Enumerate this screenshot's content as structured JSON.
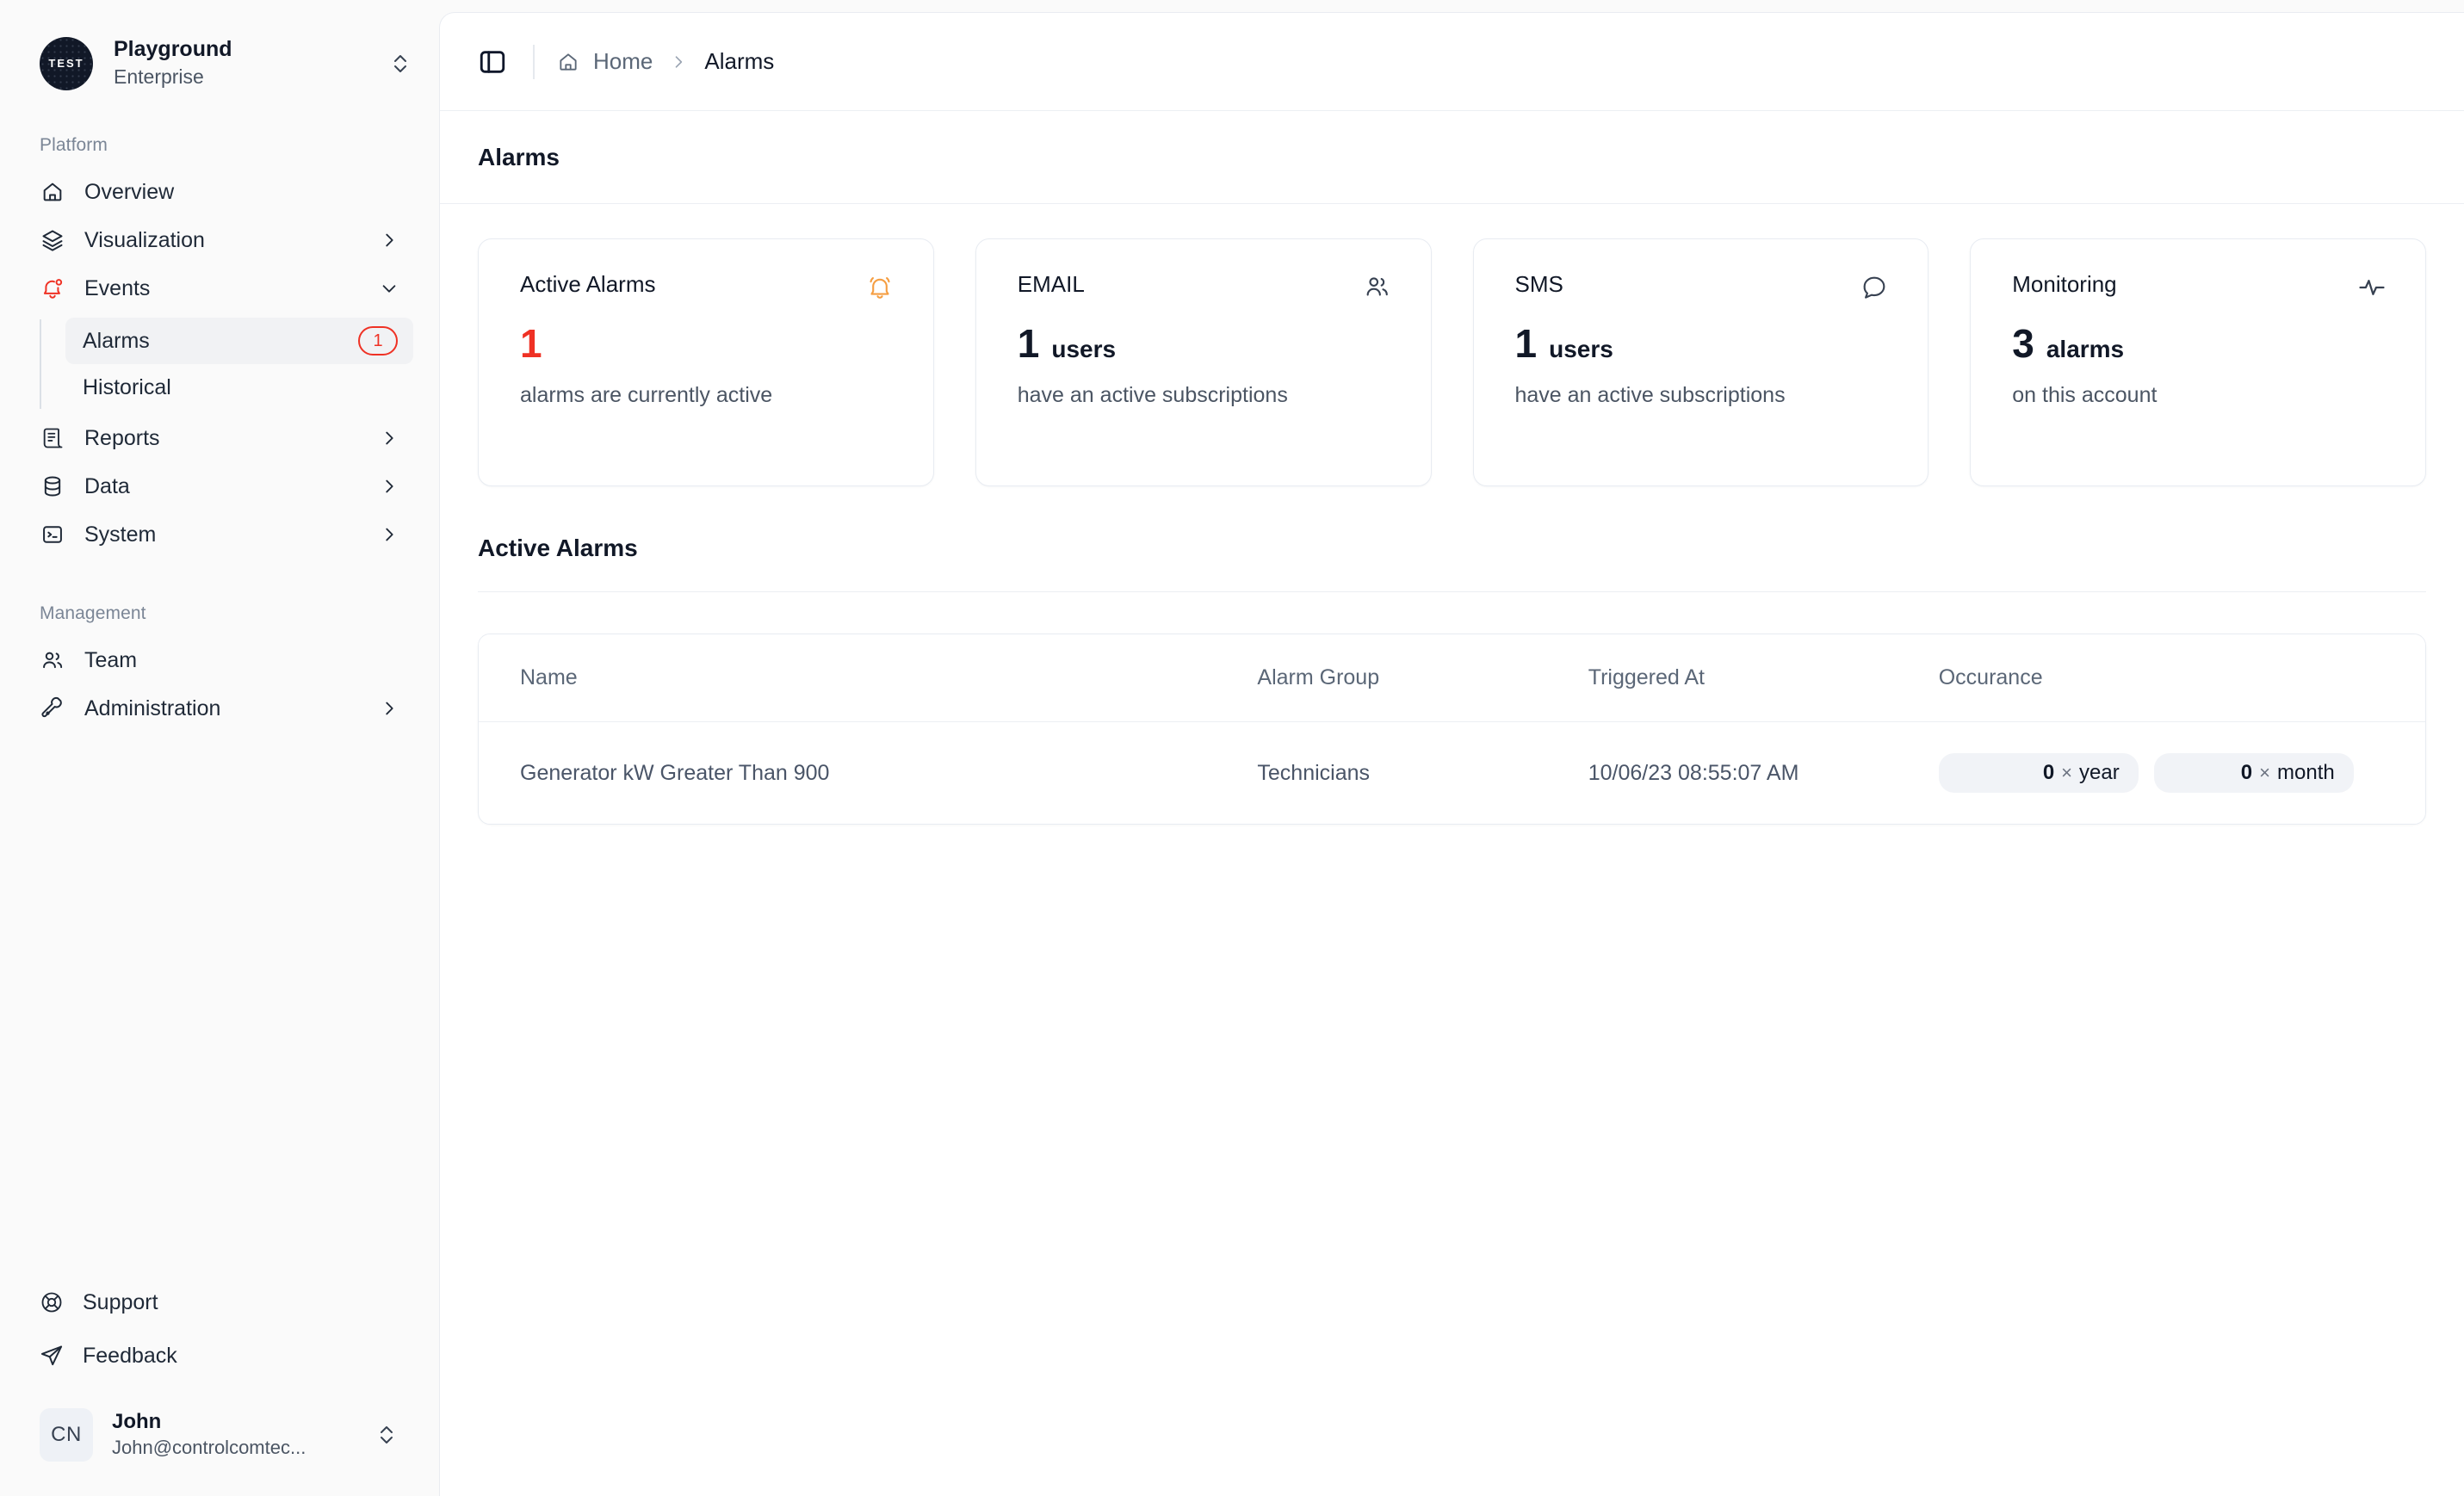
{
  "workspace": {
    "logo_text": "TEST",
    "name": "Playground",
    "plan": "Enterprise",
    "switcher_icon": "chevron-up-down-icon"
  },
  "sidebar": {
    "groups": [
      {
        "label": "Platform",
        "items": [
          {
            "label": "Overview",
            "icon": "home-icon",
            "expandable": false
          },
          {
            "label": "Visualization",
            "icon": "layers-icon",
            "expandable": true,
            "chevron": "chevron-right-icon"
          },
          {
            "label": "Events",
            "icon": "bell-alert-icon",
            "expandable": true,
            "chevron": "chevron-down-icon",
            "expanded": true,
            "children": [
              {
                "label": "Alarms",
                "active": true,
                "badge": "1"
              },
              {
                "label": "Historical",
                "active": false,
                "badge": null
              }
            ]
          },
          {
            "label": "Reports",
            "icon": "report-icon",
            "expandable": true,
            "chevron": "chevron-right-icon"
          },
          {
            "label": "Data",
            "icon": "database-icon",
            "expandable": true,
            "chevron": "chevron-right-icon"
          },
          {
            "label": "System",
            "icon": "terminal-icon",
            "expandable": true,
            "chevron": "chevron-right-icon"
          }
        ]
      },
      {
        "label": "Management",
        "items": [
          {
            "label": "Team",
            "icon": "users-icon",
            "expandable": false
          },
          {
            "label": "Administration",
            "icon": "wrench-icon",
            "expandable": true,
            "chevron": "chevron-right-icon"
          }
        ]
      }
    ],
    "footer": [
      {
        "label": "Support",
        "icon": "lifebuoy-icon"
      },
      {
        "label": "Feedback",
        "icon": "send-icon"
      }
    ],
    "user": {
      "initials": "CN",
      "name": "John",
      "email": "John@controlcomtec...",
      "switcher_icon": "chevron-up-down-icon"
    }
  },
  "topbar": {
    "toggle_icon": "sidebar-toggle-icon",
    "breadcrumb": {
      "home_icon": "home-icon",
      "home_label": "Home",
      "separator_icon": "chevron-right-icon",
      "current_label": "Alarms"
    }
  },
  "page": {
    "title": "Alarms"
  },
  "cards": [
    {
      "title": "Active Alarms",
      "icon": "bell-ring-icon",
      "icon_color": "#f59e42",
      "value": "1",
      "value_color": "#ef3124",
      "unit": "",
      "subtitle": "alarms are currently active"
    },
    {
      "title": "EMAIL",
      "icon": "users-icon",
      "icon_color": "#374151",
      "value": "1",
      "value_color": "#111827",
      "unit": "users",
      "subtitle": "have an active subscriptions"
    },
    {
      "title": "SMS",
      "icon": "message-icon",
      "icon_color": "#374151",
      "value": "1",
      "value_color": "#111827",
      "unit": "users",
      "subtitle": "have an active subscriptions"
    },
    {
      "title": "Monitoring",
      "icon": "activity-icon",
      "icon_color": "#374151",
      "value": "3",
      "value_color": "#111827",
      "unit": "alarms",
      "subtitle": "on this account"
    }
  ],
  "active_alarms": {
    "section_title": "Active Alarms",
    "columns": [
      "Name",
      "Alarm Group",
      "Triggered At",
      "Occurance"
    ],
    "rows": [
      {
        "name": "Generator kW Greater Than 900",
        "alarm_group": "Technicians",
        "triggered_at": "10/06/23 08:55:07 AM",
        "occurrence": [
          {
            "count": "0",
            "sep": "×",
            "unit": "year"
          },
          {
            "count": "0",
            "sep": "×",
            "unit": "month"
          }
        ]
      }
    ]
  },
  "colors": {
    "accent_red": "#ef3124",
    "alarm_icon_orange": "#f59e42",
    "sidebar_bg": "#fafafa",
    "main_bg": "#ffffff",
    "border": "#e8ecf2",
    "text_primary": "#111827",
    "text_muted": "#5b6777"
  }
}
